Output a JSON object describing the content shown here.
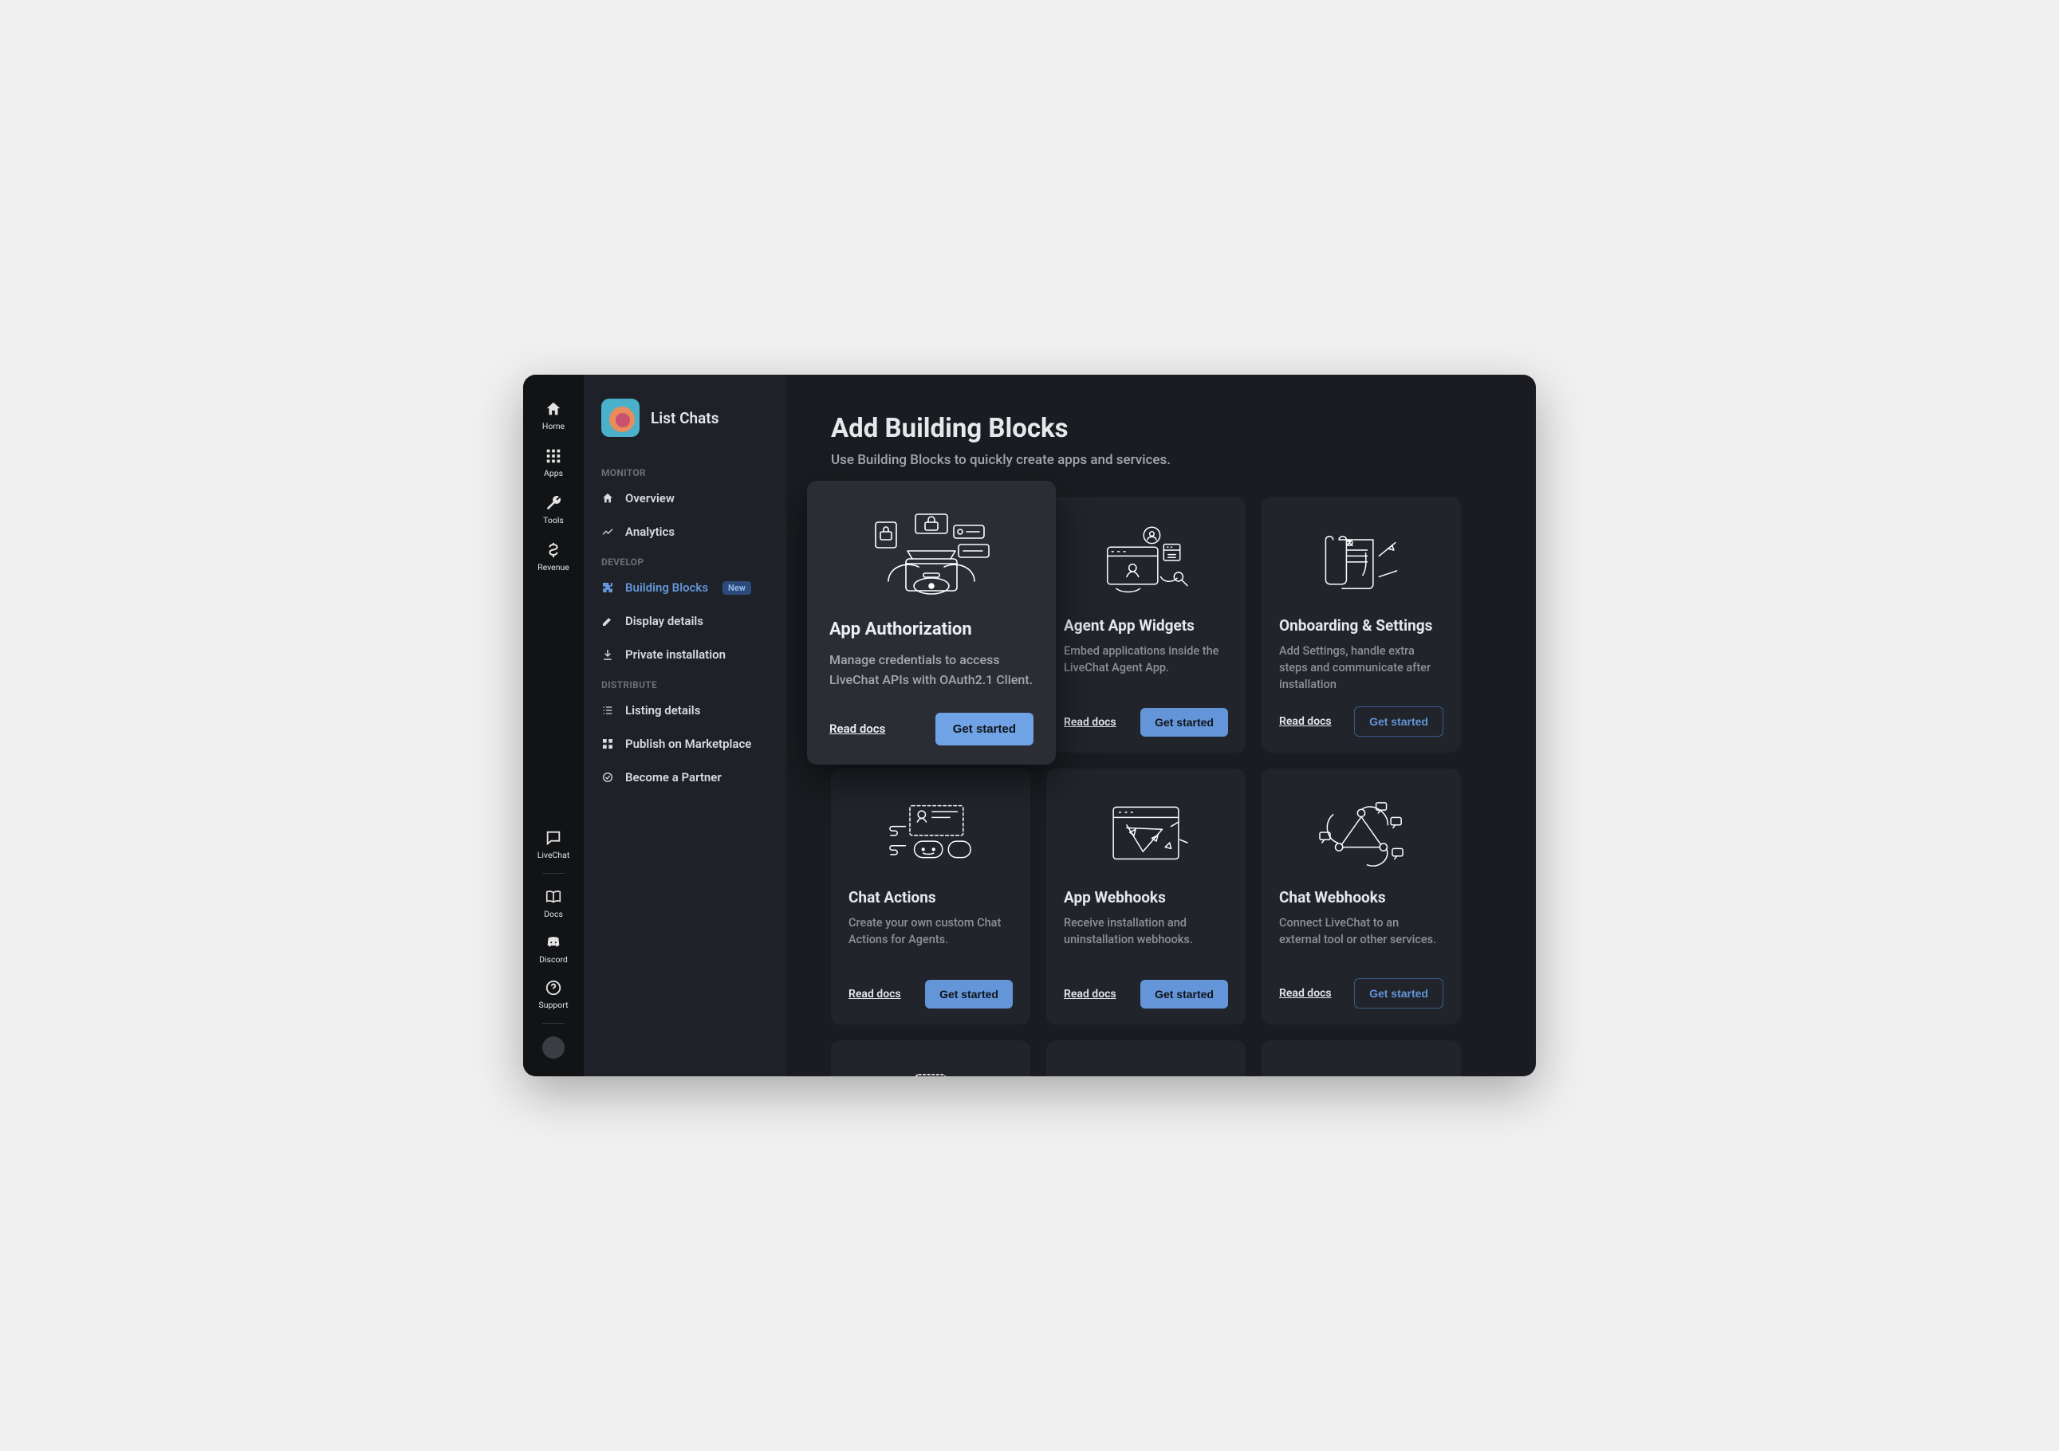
{
  "rail": {
    "top": [
      {
        "label": "Home"
      },
      {
        "label": "Apps"
      },
      {
        "label": "Tools"
      },
      {
        "label": "Revenue"
      }
    ],
    "bottom": [
      {
        "label": "LiveChat"
      },
      {
        "label": "Docs"
      },
      {
        "label": "Discord"
      },
      {
        "label": "Support"
      }
    ]
  },
  "sidebar": {
    "app_name": "List Chats",
    "sections": {
      "monitor": {
        "label": "MONITOR",
        "items": [
          {
            "label": "Overview"
          },
          {
            "label": "Analytics"
          }
        ]
      },
      "develop": {
        "label": "DEVELOP",
        "items": [
          {
            "label": "Building Blocks",
            "badge": "New",
            "active": true
          },
          {
            "label": "Display details"
          },
          {
            "label": "Private installation"
          }
        ]
      },
      "distribute": {
        "label": "DISTRIBUTE",
        "items": [
          {
            "label": "Listing details"
          },
          {
            "label": "Publish on Marketplace"
          },
          {
            "label": "Become a Partner"
          }
        ]
      }
    }
  },
  "main": {
    "title": "Add Building Blocks",
    "subtitle": "Use Building Blocks to quickly create apps and services.",
    "read_docs_label": "Read docs",
    "get_started_label": "Get started",
    "featured": {
      "title": "App Authorization",
      "desc": "Manage credentials to access LiveChat APIs with OAuth2.1 Client."
    },
    "cards": [
      {
        "title": "App Authorization",
        "desc": "Manage credentials to access LiveChat APIs with OAuth2.1 Client."
      },
      {
        "title": "Agent App Widgets",
        "desc": "Embed applications inside the LiveChat Agent App."
      },
      {
        "title": "Onboarding & Settings",
        "desc": "Add Settings, handle extra steps and communicate after installation",
        "outline": true
      },
      {
        "title": "Chat Actions",
        "desc": "Create your own custom Chat Actions for Agents."
      },
      {
        "title": "App Webhooks",
        "desc": "Receive installation and uninstallation webhooks."
      },
      {
        "title": "Chat Webhooks",
        "desc": "Connect LiveChat to an external tool or other services.",
        "outline": true
      }
    ]
  },
  "colors": {
    "accent": "#6495d9",
    "bg_dark": "#1a1c21",
    "card_bg": "#21242a"
  }
}
